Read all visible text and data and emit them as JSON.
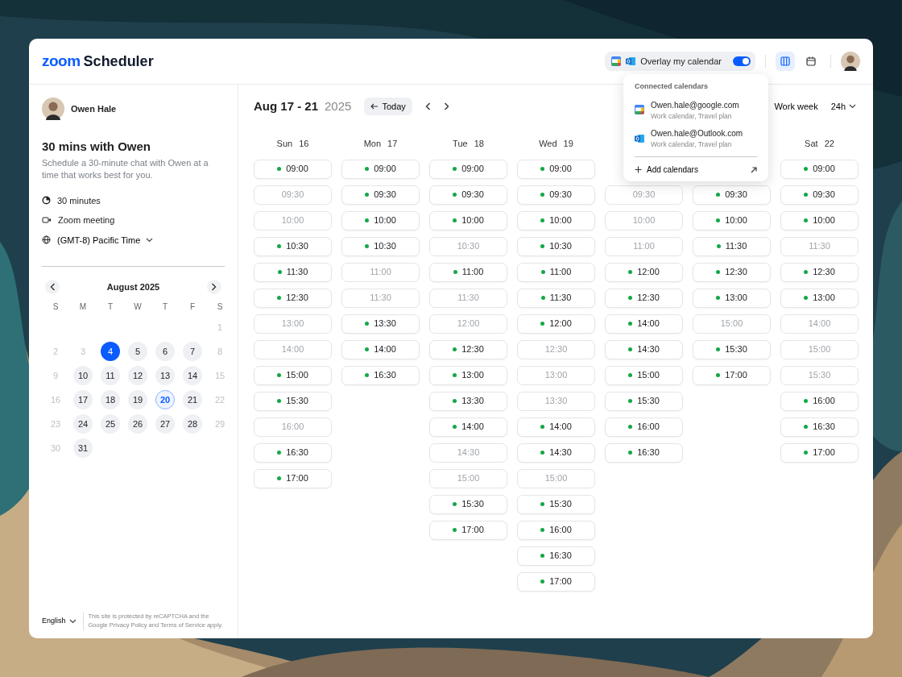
{
  "header": {
    "logo": {
      "brand": "zoom",
      "product": "Scheduler"
    },
    "overlay": {
      "label": "Overlay my calendar",
      "on": true
    },
    "views": [
      {
        "kind": "week",
        "selected": true
      },
      {
        "kind": "month",
        "selected": false
      }
    ]
  },
  "calendars_menu": {
    "title": "Connected calendars",
    "accounts": [
      {
        "kind": "google",
        "email": "Owen.hale@google.com",
        "calendars": "Work calendar, Travel plan"
      },
      {
        "kind": "outlook",
        "email": "Owen.hale@Outlook.com",
        "calendars": "Work calendar, Travel plan"
      }
    ],
    "add": "Add calendars"
  },
  "host": {
    "name": "Owen Hale"
  },
  "event": {
    "title": "30 mins with Owen",
    "description": "Schedule a 30-minute chat with Owen at a time that works best for you.",
    "details": [
      {
        "kind": "duration",
        "text": "30 minutes"
      },
      {
        "kind": "video",
        "text": "Zoom meeting"
      },
      {
        "kind": "timezone",
        "text": "(GMT-8) Pacific Time"
      }
    ]
  },
  "month": {
    "title": "August 2025",
    "weekdays": [
      "S",
      "M",
      "T",
      "W",
      "T",
      "F",
      "S"
    ],
    "weeks": [
      [
        {
          "label": "1",
          "kind": "off",
          "selected": false
        }
      ],
      [
        {
          "label": "2",
          "kind": "off",
          "selected": false
        },
        {
          "label": "3",
          "kind": "off",
          "selected": false
        },
        {
          "label": "4",
          "kind": "open",
          "selected": true
        },
        {
          "label": "5",
          "kind": "open",
          "selected": false
        },
        {
          "label": "6",
          "kind": "open",
          "selected": false
        },
        {
          "label": "7",
          "kind": "open",
          "selected": false
        },
        {
          "label": "8",
          "kind": "off",
          "selected": false
        }
      ],
      [
        {
          "label": "9",
          "kind": "off",
          "selected": false
        },
        {
          "label": "10",
          "kind": "open",
          "selected": false
        },
        {
          "label": "11",
          "kind": "open",
          "selected": false
        },
        {
          "label": "12",
          "kind": "open",
          "selected": false
        },
        {
          "label": "13",
          "kind": "open",
          "selected": false
        },
        {
          "label": "14",
          "kind": "open",
          "selected": false
        },
        {
          "label": "15",
          "kind": "off",
          "selected": false
        }
      ],
      [
        {
          "label": "16",
          "kind": "off",
          "selected": false
        },
        {
          "label": "17",
          "kind": "open",
          "selected": false
        },
        {
          "label": "18",
          "kind": "open",
          "selected": false
        },
        {
          "label": "19",
          "kind": "open",
          "selected": false
        },
        {
          "label": "20",
          "kind": "today",
          "selected": false
        },
        {
          "label": "21",
          "kind": "open",
          "selected": false
        },
        {
          "label": "22",
          "kind": "off",
          "selected": false
        }
      ],
      [
        {
          "label": "23",
          "kind": "off",
          "selected": false
        },
        {
          "label": "24",
          "kind": "open",
          "selected": false
        },
        {
          "label": "25",
          "kind": "open",
          "selected": false
        },
        {
          "label": "26",
          "kind": "open",
          "selected": false
        },
        {
          "label": "27",
          "kind": "open",
          "selected": false
        },
        {
          "label": "28",
          "kind": "open",
          "selected": false
        },
        {
          "label": "29",
          "kind": "off",
          "selected": false
        }
      ],
      [
        {
          "label": "30",
          "kind": "off",
          "selected": false
        },
        {
          "label": "31",
          "kind": "open",
          "selected": false
        }
      ]
    ]
  },
  "footer": {
    "language": "English",
    "notice": "This site is protected by reCAPTCHA and the Google Privacy Policy and Terms of Service apply."
  },
  "toolbar": {
    "range": "Aug 17 - 21",
    "year": "2025",
    "today": "Today",
    "view": "Work week",
    "hours": "24h"
  },
  "days": [
    {
      "label": "Sun",
      "date": "16",
      "slots": [
        {
          "time": "09:00",
          "available": true
        },
        {
          "time": "09:30",
          "available": false
        },
        {
          "time": "10:00",
          "available": false
        },
        {
          "time": "10:30",
          "available": true
        },
        {
          "time": "11:30",
          "available": true
        },
        {
          "time": "12:30",
          "available": true
        },
        {
          "time": "13:00",
          "available": false
        },
        {
          "time": "14:00",
          "available": false
        },
        {
          "time": "15:00",
          "available": true
        },
        {
          "time": "15:30",
          "available": true
        },
        {
          "time": "16:00",
          "available": false
        },
        {
          "time": "16:30",
          "available": true
        },
        {
          "time": "17:00",
          "available": true
        }
      ]
    },
    {
      "label": "Mon",
      "date": "17",
      "slots": [
        {
          "time": "09:00",
          "available": true
        },
        {
          "time": "09:30",
          "available": true
        },
        {
          "time": "10:00",
          "available": true
        },
        {
          "time": "10:30",
          "available": true
        },
        {
          "time": "11:00",
          "available": false
        },
        {
          "time": "11:30",
          "available": false
        },
        {
          "time": "13:30",
          "available": true
        },
        {
          "time": "14:00",
          "available": true
        },
        {
          "time": "16:30",
          "available": true
        }
      ]
    },
    {
      "label": "Tue",
      "date": "18",
      "slots": [
        {
          "time": "09:00",
          "available": true
        },
        {
          "time": "09:30",
          "available": true
        },
        {
          "time": "10:00",
          "available": true
        },
        {
          "time": "10:30",
          "available": false
        },
        {
          "time": "11:00",
          "available": true
        },
        {
          "time": "11:30",
          "available": false
        },
        {
          "time": "12:00",
          "available": false
        },
        {
          "time": "12:30",
          "available": true
        },
        {
          "time": "13:00",
          "available": true
        },
        {
          "time": "13:30",
          "available": true
        },
        {
          "time": "14:00",
          "available": true
        },
        {
          "time": "14:30",
          "available": false
        },
        {
          "time": "15:00",
          "available": false
        },
        {
          "time": "15:30",
          "available": true
        },
        {
          "time": "17:00",
          "available": true
        }
      ]
    },
    {
      "label": "Wed",
      "date": "19",
      "slots": [
        {
          "time": "09:00",
          "available": true
        },
        {
          "time": "09:30",
          "available": true
        },
        {
          "time": "10:00",
          "available": true
        },
        {
          "time": "10:30",
          "available": true
        },
        {
          "time": "11:00",
          "available": true
        },
        {
          "time": "11:30",
          "available": true
        },
        {
          "time": "12:00",
          "available": true
        },
        {
          "time": "12:30",
          "available": false
        },
        {
          "time": "13:00",
          "available": false
        },
        {
          "time": "13:30",
          "available": false
        },
        {
          "time": "14:00",
          "available": true
        },
        {
          "time": "14:30",
          "available": true
        },
        {
          "time": "15:00",
          "available": false
        },
        {
          "time": "15:30",
          "available": true
        },
        {
          "time": "16:00",
          "available": true
        },
        {
          "time": "16:30",
          "available": true
        },
        {
          "time": "17:00",
          "available": true
        }
      ]
    },
    {
      "first_slot_covered": true,
      "slots": [
        {
          "time": "09:30",
          "available": false
        },
        {
          "time": "10:00",
          "available": false
        },
        {
          "time": "11:00",
          "available": false
        },
        {
          "time": "12:00",
          "available": true
        },
        {
          "time": "12:30",
          "available": true
        },
        {
          "time": "14:00",
          "available": true
        },
        {
          "time": "14:30",
          "available": true
        },
        {
          "time": "15:00",
          "available": true
        },
        {
          "time": "15:30",
          "available": true
        },
        {
          "time": "16:00",
          "available": true
        },
        {
          "time": "16:30",
          "available": true
        }
      ]
    },
    {
      "first_slot_covered": true,
      "slots": [
        {
          "time": "09:30",
          "available": true
        },
        {
          "time": "10:00",
          "available": true
        },
        {
          "time": "11:30",
          "available": true
        },
        {
          "time": "12:30",
          "available": true
        },
        {
          "time": "13:00",
          "available": true
        },
        {
          "time": "15:00",
          "available": false
        },
        {
          "time": "15:30",
          "available": true
        },
        {
          "time": "17:00",
          "available": true
        }
      ]
    },
    {
      "label": "Sat",
      "date": "22",
      "slots": [
        {
          "time": "09:00",
          "available": true
        },
        {
          "time": "09:30",
          "available": true
        },
        {
          "time": "10:00",
          "available": true
        },
        {
          "time": "11:30",
          "available": false
        },
        {
          "time": "12:30",
          "available": true
        },
        {
          "time": "13:00",
          "available": true
        },
        {
          "time": "14:00",
          "available": false
        },
        {
          "time": "15:00",
          "available": false
        },
        {
          "time": "15:30",
          "available": false
        },
        {
          "time": "16:00",
          "available": true
        },
        {
          "time": "16:30",
          "available": true
        },
        {
          "time": "17:00",
          "available": true
        }
      ]
    }
  ]
}
